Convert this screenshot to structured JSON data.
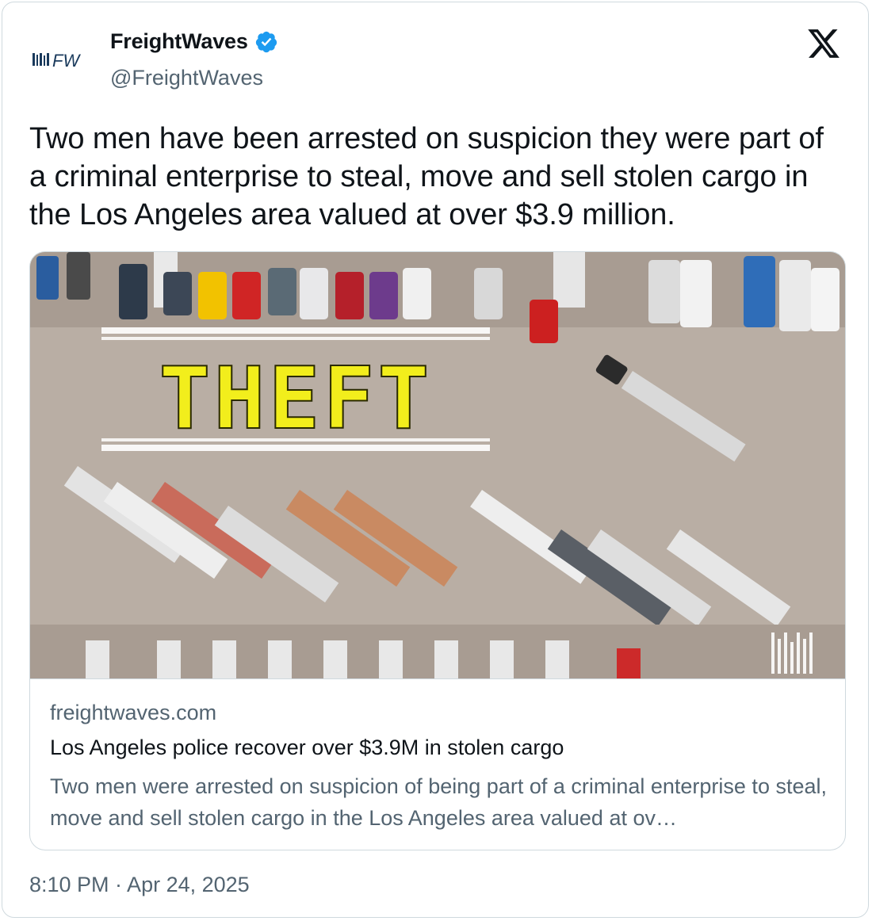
{
  "author": {
    "avatar_text": "FW",
    "name": "FreightWaves",
    "handle": "@FreightWaves",
    "verified_icon": "verified-badge-icon"
  },
  "platform_icon": "x-logo-icon",
  "tweet": {
    "text": "Two men have been arrested on suspicion they were part of a criminal enterprise to steal, move and sell stolen cargo in the Los Angeles area valued at over $3.9 million."
  },
  "link_card": {
    "image_overlay_text": "THEFT",
    "domain": "freightwaves.com",
    "title": "Los Angeles police recover over $3.9M in stolen cargo",
    "description": "Two men were arrested on suspicion of being part of a criminal enterprise to steal, move and sell stolen cargo in the Los Angeles area valued at ov…"
  },
  "timestamp": "8:10 PM · Apr 24, 2025",
  "colors": {
    "verified_blue": "#1d9bf0",
    "text_primary": "#0f1419",
    "text_secondary": "#536471",
    "border": "#cfd9de",
    "theft_yellow": "#f2ee1c"
  }
}
